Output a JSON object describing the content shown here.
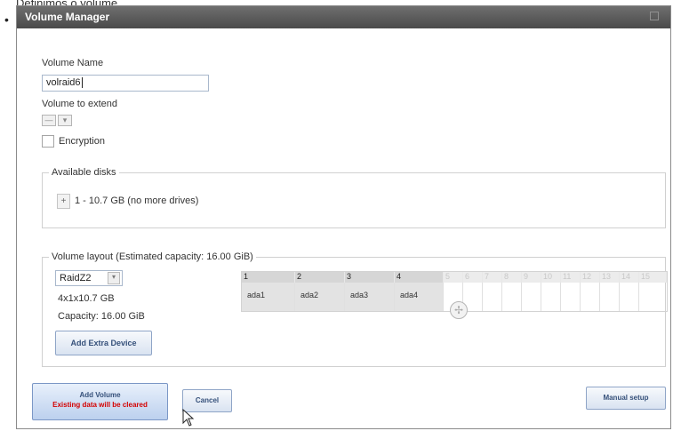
{
  "page": {
    "caption": "Definimos o volume,",
    "bullet": "•"
  },
  "dialog": {
    "title": "Volume Manager",
    "volume_name_label": "Volume Name",
    "volume_name_value": "volraid6",
    "extend_label": "Volume to extend",
    "extend_value": "—",
    "encryption_label": "Encryption",
    "available_disks_legend": "Available disks",
    "available_disks_text": "1 - 10.7 GB (no more drives)",
    "layout_legend": "Volume layout (Estimated capacity: 16.00 GiB)",
    "layout_type": "RaidZ2",
    "layout_devices": "4x1x10.7 GB",
    "layout_capacity": "Capacity: 16.00 GiB",
    "add_extra_device": "Add Extra Device",
    "grid": {
      "headers": [
        "1",
        "2",
        "3",
        "4",
        "5",
        "6",
        "7",
        "8",
        "9",
        "10",
        "11",
        "12",
        "13",
        "14",
        "15"
      ],
      "disks": [
        "ada1",
        "ada2",
        "ada3",
        "ada4"
      ]
    },
    "buttons": {
      "add_volume": "Add Volume",
      "add_volume_warning": "Existing data will be cleared",
      "cancel": "Cancel",
      "manual_setup": "Manual setup"
    }
  },
  "colors": {
    "titlebar": "#555555",
    "warning_text": "#d40000",
    "button_text": "#35507a"
  }
}
